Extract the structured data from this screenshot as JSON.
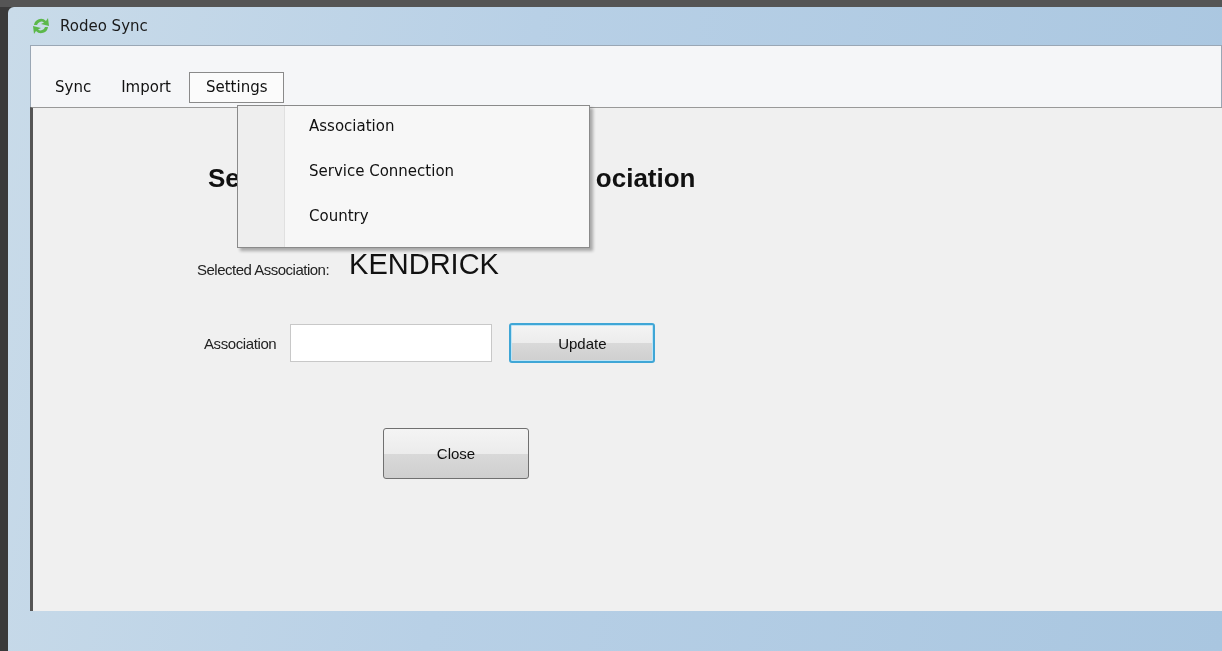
{
  "window": {
    "title": "Rodeo Sync"
  },
  "menu_bar": [
    {
      "label": "Sync",
      "selected": false
    },
    {
      "label": "Import",
      "selected": false
    },
    {
      "label": "Settings",
      "selected": true
    }
  ],
  "open_menu": {
    "items": [
      "Association",
      "Service Connection",
      "Country"
    ]
  },
  "heading": {
    "visible_left": "Se",
    "visible_right": "ociation"
  },
  "selected_association": {
    "label": "Selected Association:",
    "value": "KENDRICK"
  },
  "association_field": {
    "label": "Association"
  },
  "buttons": [
    {
      "label": "Update",
      "focused": true
    },
    {
      "label": "Close",
      "focused": false
    }
  ]
}
